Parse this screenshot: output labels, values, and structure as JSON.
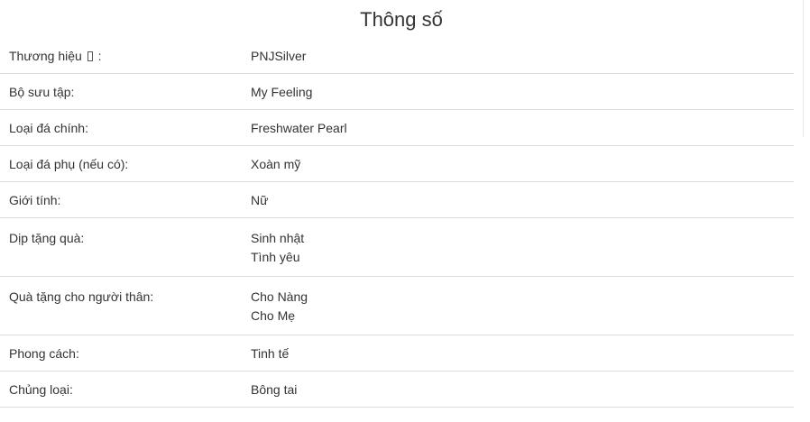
{
  "title": "Thông số",
  "rows": [
    {
      "label_text": "Thương hiệu",
      "label_suffix": ":",
      "values": [
        "PNJSilver"
      ]
    },
    {
      "label": "Bộ sưu tập:",
      "values": [
        "My Feeling"
      ]
    },
    {
      "label": "Loại đá chính:",
      "values": [
        "Freshwater Pearl"
      ]
    },
    {
      "label": "Loại đá phụ (nếu có):",
      "values": [
        "Xoàn mỹ"
      ]
    },
    {
      "label": "Giới tính:",
      "values": [
        "Nữ"
      ]
    },
    {
      "label": "Dịp tặng quà:",
      "values": [
        "Sinh nhật",
        "Tình yêu"
      ]
    },
    {
      "label": "Quà tặng cho người thân:",
      "values": [
        "Cho Nàng",
        "Cho Mẹ"
      ]
    },
    {
      "label": "Phong cách:",
      "values": [
        "Tinh tế"
      ]
    },
    {
      "label": "Chủng loại:",
      "values": [
        "Bông tai"
      ]
    }
  ]
}
